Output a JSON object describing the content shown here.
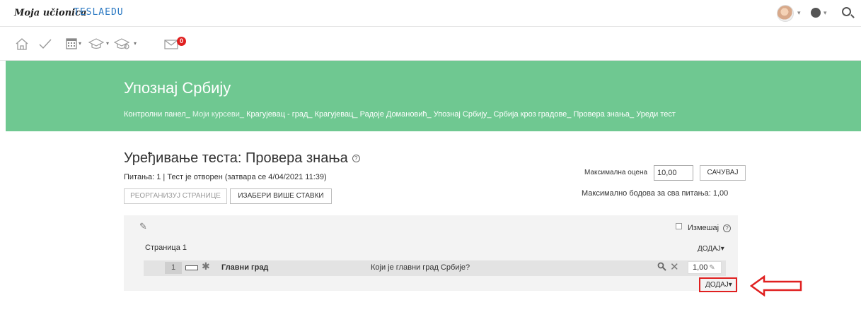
{
  "topbar": {
    "brand": "Moja učionica",
    "logo": "TESLAEDU",
    "caret": "▾"
  },
  "navbar": {
    "badge_count": "0"
  },
  "hero": {
    "title": "Упознај Србију",
    "breadcrumb": [
      {
        "label": "Контролни панел_",
        "muted": false
      },
      {
        "label": "Моји курсеви_",
        "muted": true
      },
      {
        "label": "Крагујевац - град_",
        "muted": false
      },
      {
        "label": "Крагујевац_",
        "muted": false
      },
      {
        "label": "Радоје Домановић_",
        "muted": false
      },
      {
        "label": "Упознај Србију_",
        "muted": false
      },
      {
        "label": "Србија кроз градове_",
        "muted": false
      },
      {
        "label": "Провера знања_",
        "muted": false
      },
      {
        "label": "Уреди тест",
        "muted": false
      }
    ]
  },
  "main": {
    "title": "Уређивање теста: Провера знања",
    "status": "Питања: 1 | Тест је отворен (затвара се 4/04/2021 11:39)",
    "reorganize_label": "РЕОРГАНИЗУЈ СТРАНИЦЕ",
    "select_multiple_label": "ИЗАБЕРИ ВИШЕ СТАВКИ",
    "max_grade_label": "Максимална оцена",
    "max_grade_value": "10,00",
    "save_label": "САЧУВАЈ",
    "max_points": "Максимално бодова за сва питања: 1,00"
  },
  "panel": {
    "shuffle_label": "Измешај",
    "page_label": "Страница 1",
    "add_label": "ДОДАЈ▾",
    "question": {
      "number": "1",
      "name": "Главни град",
      "text": "Који је главни град Србије?",
      "mark": "1,00"
    }
  },
  "colors": {
    "hero": "#6fc891",
    "highlight": "#e02020"
  }
}
